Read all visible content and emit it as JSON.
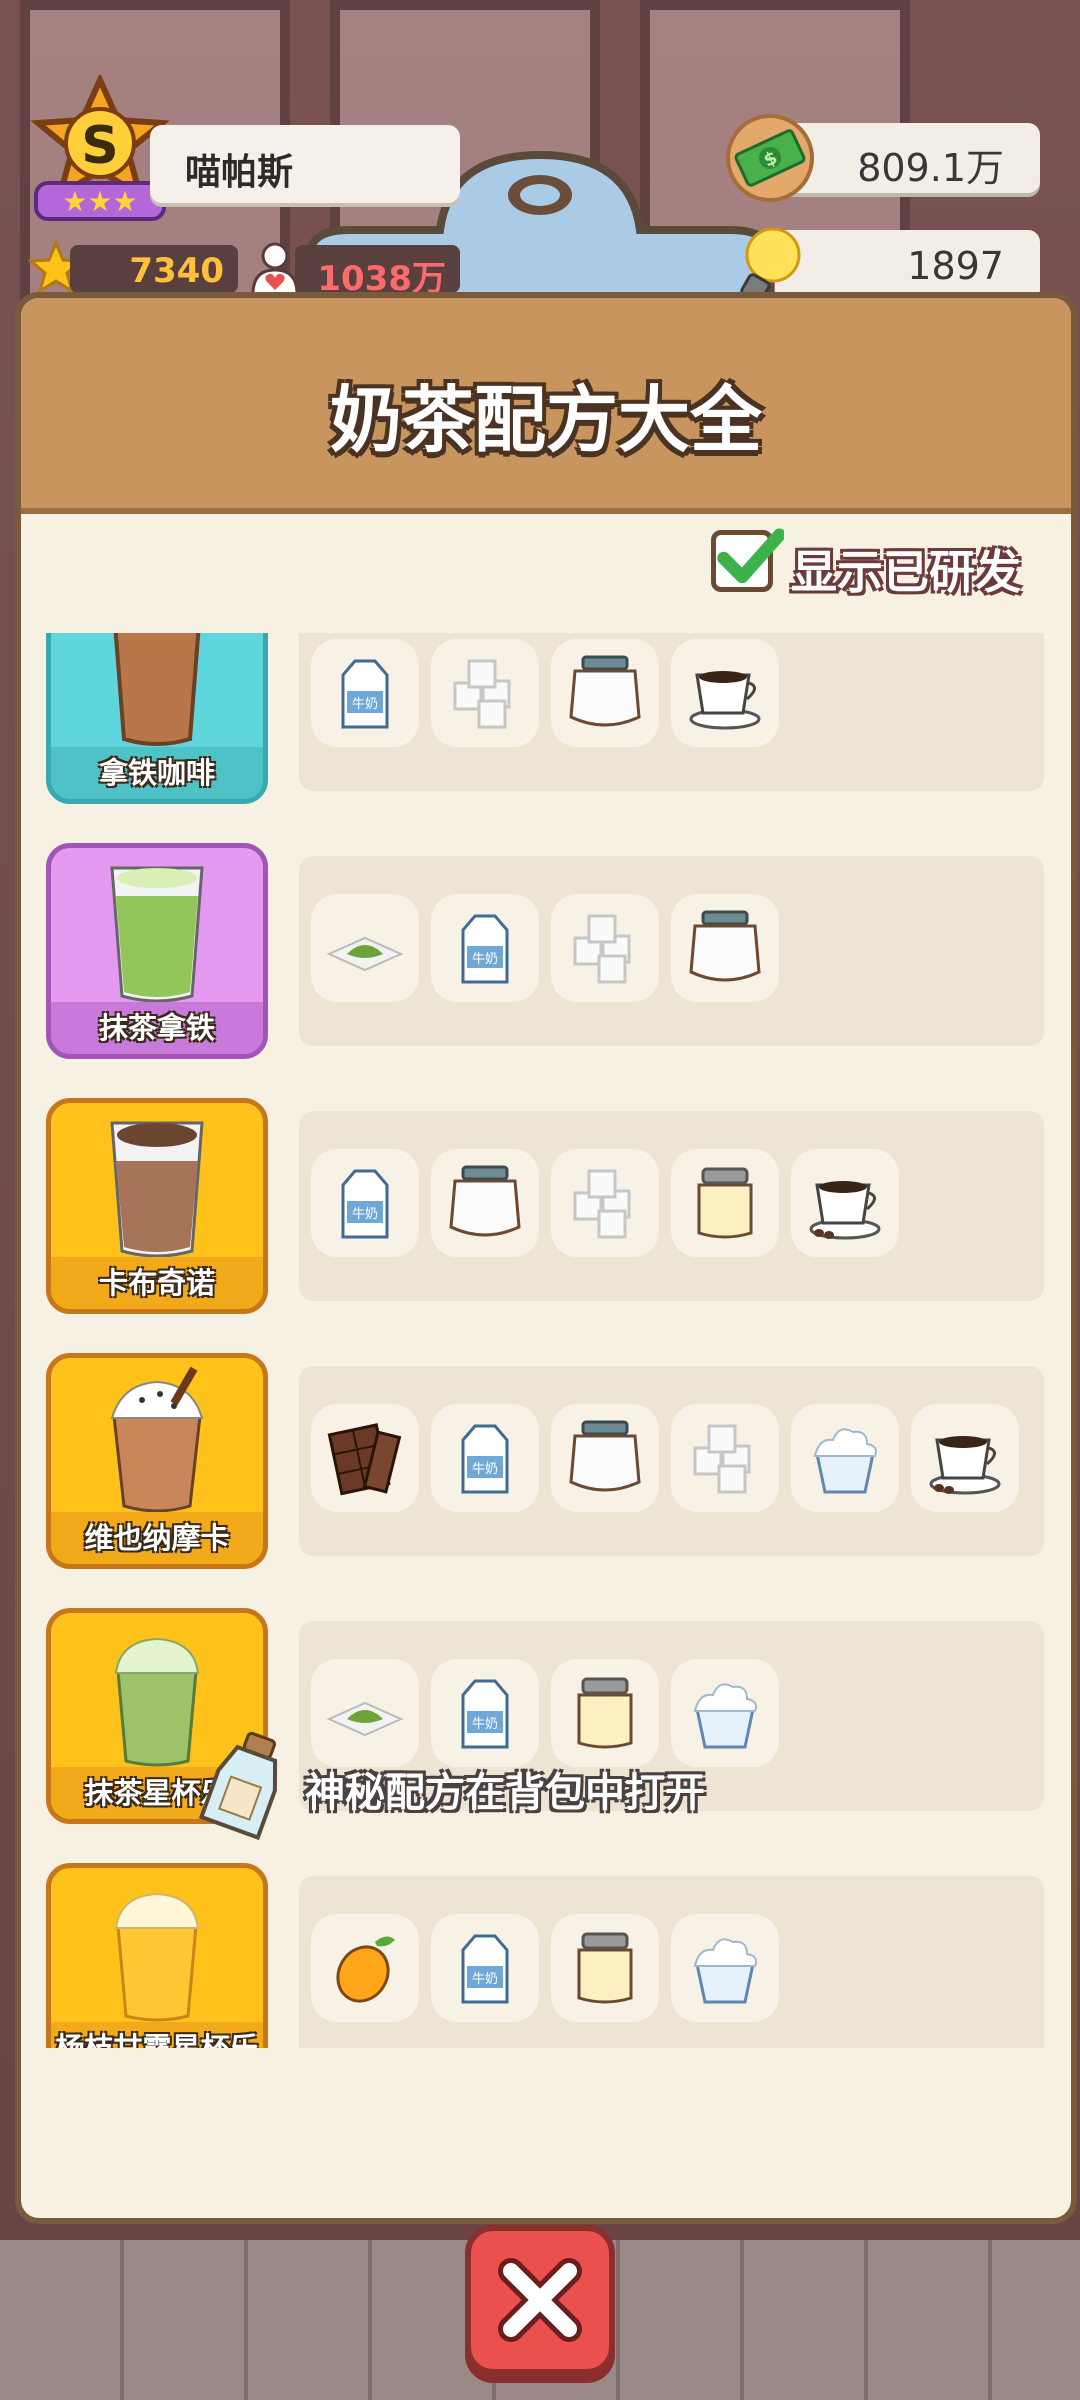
{
  "player": {
    "name": "喵帕斯",
    "rank": "S",
    "stars": "7340",
    "fans": "1038万"
  },
  "resources": {
    "money": "809.1万",
    "ideas": "1897"
  },
  "panel": {
    "title": "奶茶配方大全",
    "toggle_label": "显示已研发",
    "toggle_checked": true
  },
  "recipes": [
    {
      "name": "拿铁咖啡",
      "card_color": "#5fd6dc",
      "ingredients": [
        "milk-carton-icon",
        "sugar-cubes-icon",
        "cream-jar-icon",
        "coffee-cup-icon"
      ]
    },
    {
      "name": "抹茶拿铁",
      "card_color": "#e39af0",
      "ingredients": [
        "matcha-powder-icon",
        "milk-carton-icon",
        "sugar-cubes-icon",
        "cream-jar-icon"
      ]
    },
    {
      "name": "卡布奇诺",
      "card_color": "#ffc21a",
      "ingredients": [
        "milk-carton-icon",
        "cream-jar-icon",
        "sugar-cubes-icon",
        "condensed-milk-icon",
        "coffee-cup-icon"
      ]
    },
    {
      "name": "维也纳摩卡",
      "card_color": "#ffc21a",
      "ingredients": [
        "chocolate-bar-icon",
        "milk-carton-icon",
        "cream-jar-icon",
        "sugar-cubes-icon",
        "whipped-cream-icon",
        "coffee-cup-icon"
      ]
    },
    {
      "name": "抹茶星杯乐",
      "card_color": "#ffc21a",
      "ingredients": [
        "matcha-powder-icon",
        "milk-carton-icon",
        "condensed-milk-icon",
        "whipped-cream-icon"
      ]
    },
    {
      "name": "杨枝甘露星杯乐",
      "card_color": "#ffc21a",
      "ingredients": [
        "mango-icon",
        "milk-carton-icon",
        "condensed-milk-icon",
        "whipped-cream-icon"
      ]
    }
  ],
  "milk_label": "牛奶",
  "footer": {
    "hint": "神秘配方在背包中打开"
  }
}
